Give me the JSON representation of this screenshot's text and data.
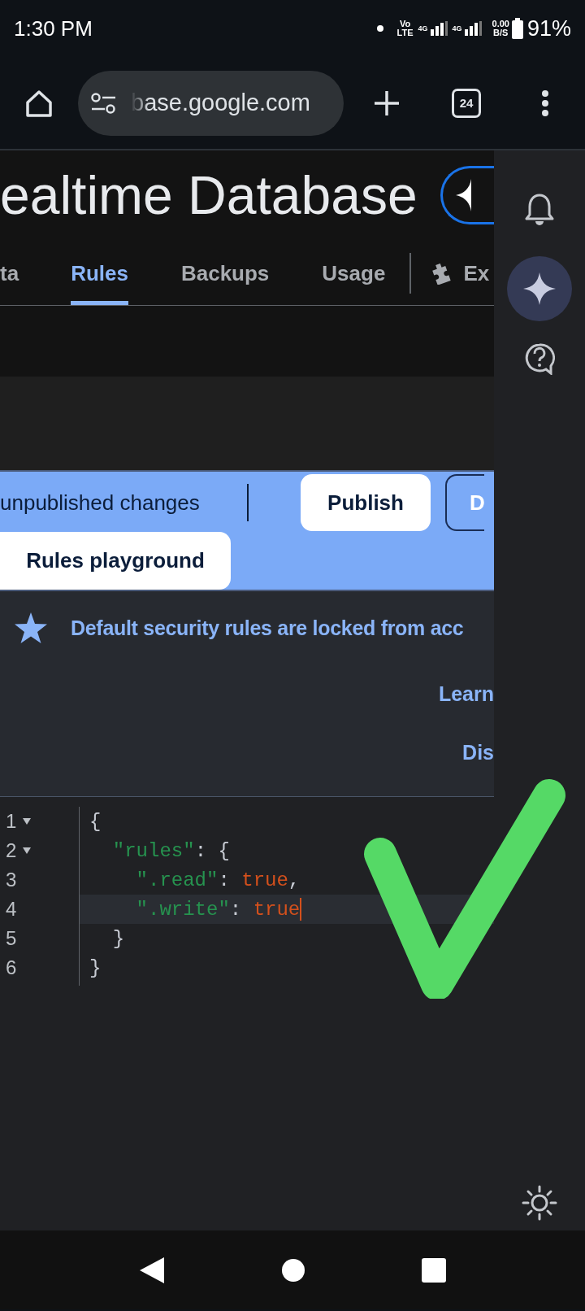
{
  "status_bar": {
    "time": "1:30 PM",
    "volte": [
      "Vo",
      "LTE"
    ],
    "networks": [
      "4G",
      "4G"
    ],
    "speed": [
      "0.00",
      "B/S"
    ],
    "battery": "91%"
  },
  "browser": {
    "url": "base.google.com",
    "tab_count": "24"
  },
  "page": {
    "title": "ealtime Database",
    "tabs": [
      {
        "label": "ta",
        "selected": false,
        "kind": "text"
      },
      {
        "label": "Rules",
        "selected": true,
        "kind": "text"
      },
      {
        "label": "Backups",
        "selected": false,
        "kind": "text"
      },
      {
        "label": "Usage",
        "selected": false,
        "kind": "text"
      },
      {
        "label": "Ex",
        "selected": false,
        "kind": "extension"
      }
    ],
    "banner": {
      "message": "unpublished changes",
      "publish": "Publish",
      "discard": "D",
      "playground": "Rules playground"
    },
    "notice": {
      "text": "Default security rules are locked from acc",
      "links": [
        "Learn",
        "Dis"
      ]
    },
    "editor": {
      "lines": [
        {
          "number": "1",
          "foldable": true,
          "active": false,
          "cursor": false,
          "tokens": [
            {
              "kind": "punct",
              "text": "{"
            }
          ]
        },
        {
          "number": "2",
          "foldable": true,
          "active": false,
          "cursor": false,
          "tokens": [
            {
              "kind": "key",
              "text": "  \"rules\""
            },
            {
              "kind": "punct",
              "text": ": {"
            }
          ]
        },
        {
          "number": "3",
          "foldable": false,
          "active": false,
          "cursor": false,
          "tokens": [
            {
              "kind": "key",
              "text": "    \".read\""
            },
            {
              "kind": "punct",
              "text": ": "
            },
            {
              "kind": "bool",
              "text": "true"
            },
            {
              "kind": "punct",
              "text": ","
            }
          ]
        },
        {
          "number": "4",
          "foldable": false,
          "active": true,
          "cursor": true,
          "tokens": [
            {
              "kind": "key",
              "text": "    \".write\""
            },
            {
              "kind": "punct",
              "text": ": "
            },
            {
              "kind": "bool",
              "text": "true"
            }
          ]
        },
        {
          "number": "5",
          "foldable": false,
          "active": false,
          "cursor": false,
          "tokens": [
            {
              "kind": "punct",
              "text": "  }"
            }
          ]
        },
        {
          "number": "6",
          "foldable": false,
          "active": false,
          "cursor": false,
          "tokens": [
            {
              "kind": "punct",
              "text": "}"
            }
          ]
        }
      ]
    }
  }
}
